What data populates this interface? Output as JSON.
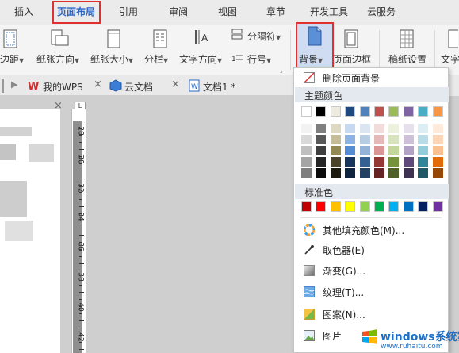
{
  "menubar": {
    "tabs": [
      {
        "label": "插入"
      },
      {
        "label": "页面布局",
        "active": true
      },
      {
        "label": "引用"
      },
      {
        "label": "审阅"
      },
      {
        "label": "视图"
      },
      {
        "label": "章节"
      },
      {
        "label": "开发工具"
      },
      {
        "label": "云服务"
      }
    ]
  },
  "ribbon": {
    "margins_label": "边距",
    "orientation_label": "纸张方向",
    "size_label": "纸张大小",
    "columns_label": "分栏",
    "text_direction_label": "文字方向",
    "separator_label": "分隔符",
    "line_number_label": "行号",
    "background_label": "背景",
    "page_border_label": "页面边框",
    "manuscript_label": "稿纸设置",
    "text_cut_label": "文字"
  },
  "doctabs": {
    "tabs": [
      {
        "label": "我的WPS"
      },
      {
        "label": "云文档"
      },
      {
        "label": "文档1 *"
      }
    ]
  },
  "ruler": {
    "numbers": [
      "28",
      "30",
      "32",
      "34",
      "36",
      "38",
      "40",
      "42"
    ]
  },
  "dropdown": {
    "remove_bg": "删除页面背景",
    "theme_colors_title": "主题颜色",
    "standard_colors_title": "标准色",
    "more_colors": "其他填充颜色(M)...",
    "eyedropper": "取色器(E)",
    "gradient": "渐变(G)...",
    "texture": "纹理(T)...",
    "pattern": "图案(N)...",
    "picture": "图片",
    "colors": {
      "theme_top_row": [
        "#ffffff",
        "#000000",
        "#eeece1",
        "#1f497d",
        "#4f81bd",
        "#c0504d",
        "#9bbb59",
        "#8064a2",
        "#4bacc6",
        "#f79646"
      ],
      "theme_rows": [
        [
          "#f2f2f2",
          "#7f7f7f",
          "#ddd9c3",
          "#c6d9f0",
          "#dbe5f1",
          "#f2dcdb",
          "#ebf1dd",
          "#e5e0ec",
          "#dbeef3",
          "#fdeada"
        ],
        [
          "#d8d8d8",
          "#595959",
          "#c4bd97",
          "#8db3e2",
          "#b8cce4",
          "#e5b9b7",
          "#d7e3bc",
          "#ccc1d9",
          "#b7dde8",
          "#fbd5b5"
        ],
        [
          "#bfbfbf",
          "#3f3f3f",
          "#938953",
          "#548dd4",
          "#95b3d7",
          "#d99694",
          "#c3d69b",
          "#b2a2c7",
          "#92cddc",
          "#fac08f"
        ],
        [
          "#a5a5a5",
          "#262626",
          "#494429",
          "#17365d",
          "#366092",
          "#953734",
          "#76923c",
          "#5f497a",
          "#31859b",
          "#e36c09"
        ],
        [
          "#7f7f7f",
          "#0c0c0c",
          "#1d1b10",
          "#0f243e",
          "#244061",
          "#632423",
          "#4f6128",
          "#3f3151",
          "#205867",
          "#974806"
        ]
      ],
      "standard": [
        "#c00000",
        "#ff0000",
        "#ffc000",
        "#ffff00",
        "#92d050",
        "#00b050",
        "#00b0f0",
        "#0070c0",
        "#002060",
        "#7030a0"
      ]
    }
  },
  "watermark": {
    "brand": "windows系统家园",
    "url": "www.ruhaitu.com"
  }
}
